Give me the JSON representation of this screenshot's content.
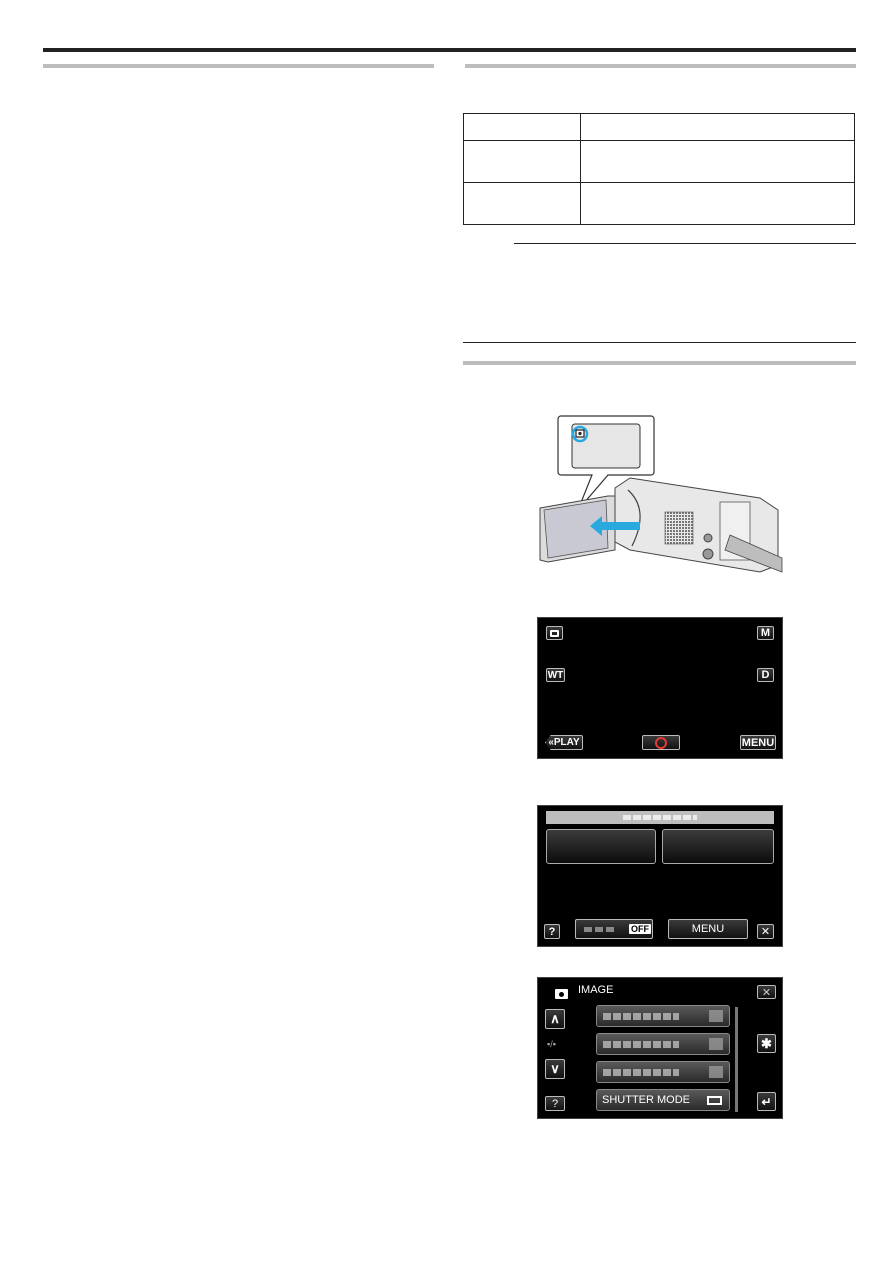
{
  "page": {
    "left_column": {
      "section_heading": "",
      "body": ""
    },
    "right_column": {
      "section1_heading": "",
      "settings_table": {
        "rows": [
          {
            "setting": "",
            "details": ""
          },
          {
            "setting": "",
            "details": ""
          },
          {
            "setting": "",
            "details": ""
          }
        ]
      },
      "note": {
        "label": "",
        "text": ""
      },
      "section2_heading": ""
    }
  },
  "figure_lcd_open": {
    "callout_icon": "still-image-mode-icon",
    "highlight_color": "#29a9e0",
    "arrow_color": "#29a9e0"
  },
  "screen_record": {
    "mode_icon": "camera-icon",
    "manual_label": "M",
    "wt_label": "WT",
    "display_label": "D",
    "play_label": "PLAY",
    "play_prefix": "«",
    "record_icon": "record-circle-icon",
    "record_color": "#e53935",
    "menu_label": "MENU"
  },
  "screen_top_menu": {
    "title": "",
    "tile_1": "",
    "tile_2": "",
    "help_label": "?",
    "toggle_label": "",
    "toggle_state": "OFF",
    "menu_label": "MENU",
    "close_label": "✕"
  },
  "screen_image_menu": {
    "mode_icon": "camera-icon",
    "title": "IMAGE",
    "page_indicator": "▪/▪",
    "up_label": "∧",
    "down_label": "∨",
    "help_label": "?",
    "close_label": "✕",
    "gear_label": "✱",
    "back_label": "↵",
    "items": [
      {
        "label": "",
        "value": ""
      },
      {
        "label": "",
        "value": ""
      },
      {
        "label": "",
        "value": ""
      },
      {
        "label": "SHUTTER MODE",
        "value_icon": "single-shot-icon"
      }
    ]
  }
}
